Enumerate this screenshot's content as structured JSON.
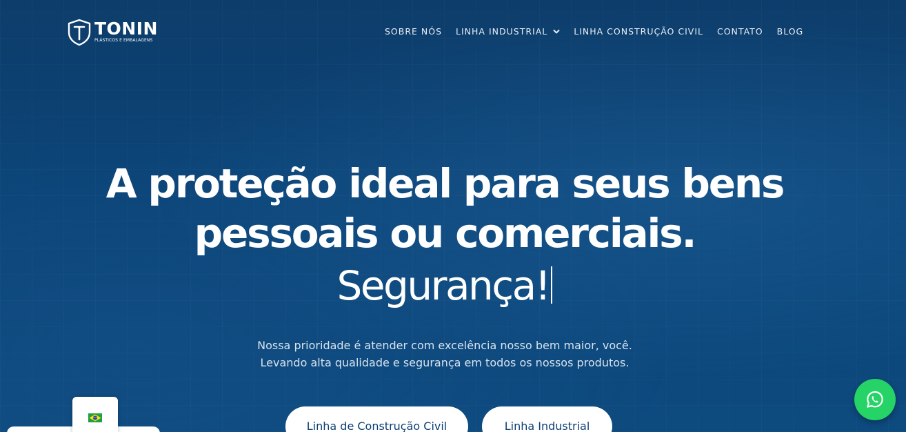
{
  "brand": {
    "name": "TONIN",
    "tagline": "PLÁSTICOS E EMBALAGENS"
  },
  "nav": {
    "items": [
      {
        "label": "SOBRE NÓS"
      },
      {
        "label": "LINHA INDUSTRIAL"
      },
      {
        "label": "LINHA CONSTRUÇÃO CIVIL"
      },
      {
        "label": "CONTATO"
      },
      {
        "label": "BLOG"
      }
    ],
    "dropdown_icon": "chevron-down-icon"
  },
  "hero": {
    "title_line1": "A proteção ideal para seus bens",
    "title_line2": "pessoais ou comerciais.",
    "typed_word": "Segurança!",
    "desc_line1": "Nossa prioridade é atender com excelência nosso bem maior, você.",
    "desc_line2": "Levando alta qualidade e segurança em todos os nossos produtos.",
    "cta_primary": "Linha de Construção Civil",
    "cta_secondary": "Linha Industrial"
  },
  "language": {
    "flag_icon": "brazil-flag-icon"
  },
  "whatsapp": {
    "icon": "whatsapp-icon",
    "color": "#25d366"
  },
  "colors": {
    "background": "#0b4477",
    "button_text": "#0b3f73",
    "accent": "#ffffff"
  }
}
